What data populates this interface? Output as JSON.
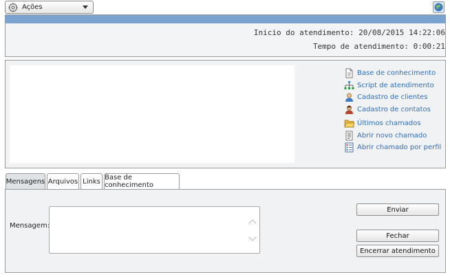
{
  "toolbar": {
    "actions_label": "Ações"
  },
  "header": {
    "start_time": "Inicio do atendimento: 20/08/2015 14:22:06",
    "elapsed_time": "Tempo de atendimento: 0:00:21"
  },
  "links": [
    {
      "label": "Base de conhecimento",
      "icon": "document-icon"
    },
    {
      "label": "Script de atendimento",
      "icon": "flowchart-icon"
    },
    {
      "label": "Cadastro de clientes",
      "icon": "user-icon"
    },
    {
      "label": "Cadastro de contatos",
      "icon": "contact-icon"
    },
    {
      "label": "Últimos chamados",
      "icon": "folder-icon"
    },
    {
      "label": "Abrir novo chamado",
      "icon": "form-icon"
    },
    {
      "label": "Abrir chamado por perfil",
      "icon": "list-icon"
    }
  ],
  "tabs": [
    {
      "label": "Mensagens",
      "active": true
    },
    {
      "label": "Arquivos"
    },
    {
      "label": "Links"
    },
    {
      "label": "Base de conhecimento"
    }
  ],
  "messages": {
    "field_label": "Mensagem:",
    "value": "",
    "send_label": "Enviar",
    "close_label": "Fechar",
    "end_label": "Encerrar atendimento"
  }
}
